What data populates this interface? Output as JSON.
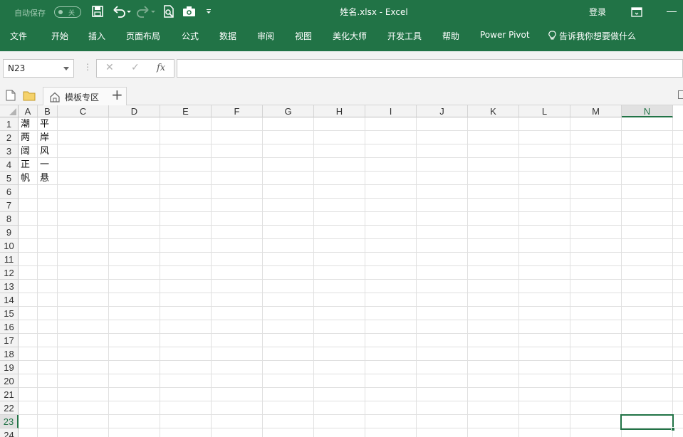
{
  "titlebar": {
    "autosave_label": "自动保存",
    "autosave_state": "关",
    "title": "姓名.xlsx  -  Excel",
    "login": "登录"
  },
  "ribbon": {
    "tabs": [
      "文件",
      "开始",
      "插入",
      "页面布局",
      "公式",
      "数据",
      "审阅",
      "视图",
      "美化大师",
      "开发工具",
      "帮助",
      "Power Pivot"
    ],
    "tell_me": "告诉我你想要做什么"
  },
  "formula_bar": {
    "name_box": "N23",
    "cancel": "✕",
    "enter": "✓",
    "fx": "fx",
    "formula": ""
  },
  "tabs_bar": {
    "template_tab": "模板专区",
    "add": "+"
  },
  "grid": {
    "columns": [
      "A",
      "B",
      "C",
      "D",
      "E",
      "F",
      "G",
      "H",
      "I",
      "J",
      "K",
      "L",
      "M",
      "N"
    ],
    "rows": [
      "1",
      "2",
      "3",
      "4",
      "5",
      "6",
      "7",
      "8",
      "9",
      "10",
      "11",
      "12",
      "13",
      "14",
      "15",
      "16",
      "17",
      "18",
      "19",
      "20",
      "21",
      "22",
      "23",
      "24"
    ],
    "selected_column": "N",
    "selected_row": "23",
    "cells": {
      "A": [
        "潮",
        "两",
        "阔",
        "正",
        "帆"
      ],
      "B": [
        "平",
        "岸",
        "风",
        "一",
        "悬"
      ]
    }
  },
  "colors": {
    "accent": "#217346"
  },
  "icons": [
    "save-icon",
    "undo-icon",
    "redo-icon",
    "print-preview-icon",
    "camera-icon",
    "customize-qat-icon",
    "ribbon-display-options-icon",
    "minimize-icon",
    "lightbulb-icon",
    "new-file-icon",
    "open-folder-icon",
    "home-icon"
  ]
}
